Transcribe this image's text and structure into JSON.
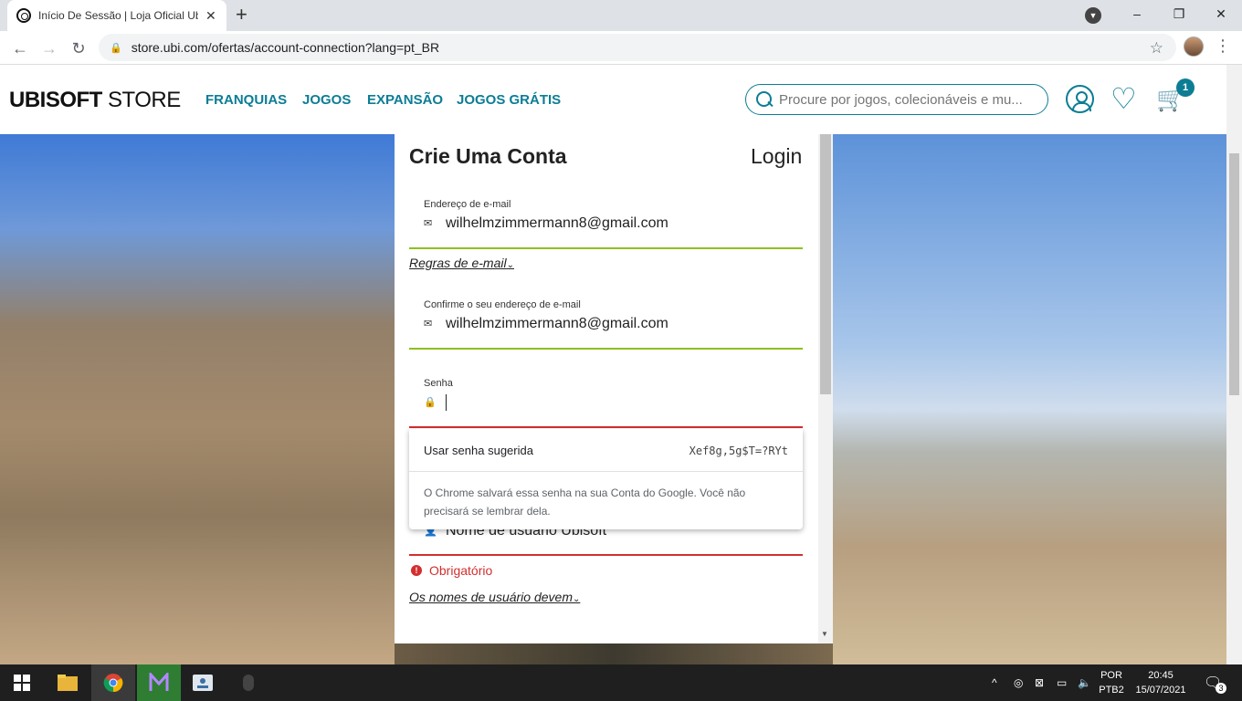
{
  "browser": {
    "tab_title": "Início De Sessão | Loja Oficial Ubi",
    "tab_close": "✕",
    "new_tab": "+",
    "url": "store.ubi.com/ofertas/account-connection?lang=pt_BR",
    "window_controls": [
      "–",
      "❐",
      "✕"
    ]
  },
  "header": {
    "logo_bold": "UBISOFT",
    "logo_light": "STORE",
    "nav": [
      "FRANQUIAS",
      "JOGOS",
      "EXPANSÃO",
      "JOGOS GRÁTIS"
    ],
    "search_placeholder": "Procure por jogos, colecionáveis e mu...",
    "cart_count": "1",
    "accent_color": "#0c7d95"
  },
  "form": {
    "title": "Crie Uma Conta",
    "login_link": "Login",
    "email": {
      "label": "Endereço de e-mail",
      "value": "wilhelmzimmermann8@gmail.com"
    },
    "email_rules": "Regras de e-mail",
    "confirm_email": {
      "label": "Confirme o seu endereço de e-mail",
      "value": "wilhelmzimmermann8@gmail.com"
    },
    "password": {
      "label": "Senha",
      "value": ""
    },
    "username_placeholder": "Nome de usuário Ubisoft",
    "required_error": "Obrigatório",
    "username_rules": "Os nomes de usuário devem",
    "valid_color": "#8fbf1f",
    "error_color": "#d32f2f"
  },
  "password_popup": {
    "use_suggested": "Usar senha sugerida",
    "suggested_password": "Xef8g,5g$T=?RYt",
    "info": "O Chrome salvará essa senha na sua Conta do Google. Você não precisará se lembrar dela."
  },
  "taskbar": {
    "lang_top": "POR",
    "lang_bottom": "PTB2",
    "time": "20:45",
    "date": "15/07/2021",
    "notifications": "3"
  }
}
